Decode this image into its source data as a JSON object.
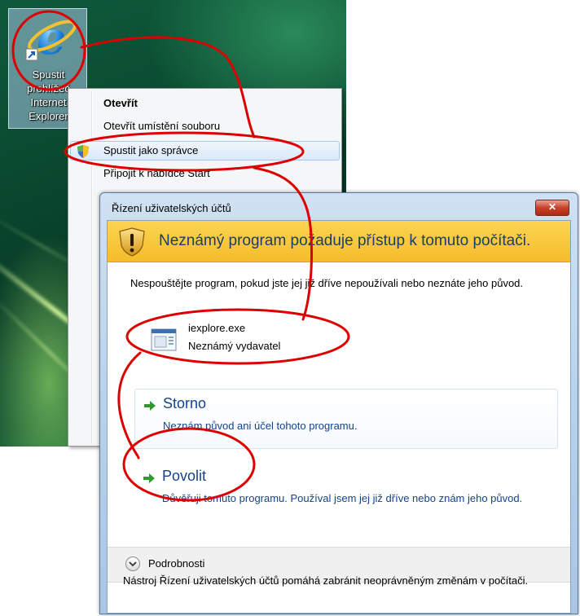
{
  "desktop": {
    "shortcut": {
      "label_lines": [
        "Spustit",
        "prohlížeč",
        "Internet",
        "Explorer"
      ]
    }
  },
  "context_menu": {
    "items": [
      {
        "label": "Otevřít",
        "bold": true
      },
      {
        "label": "Otevřít umístění souboru"
      },
      {
        "label": "Spustit jako správce",
        "highlighted": true,
        "icon": "uac-shield-icon"
      },
      {
        "label": "Připojit k nabídce Start"
      }
    ]
  },
  "uac_dialog": {
    "title": "Řízení uživatelských účtů",
    "close_label": "✕",
    "banner_text": "Neznámý program požaduje přístup k tomuto počítači.",
    "warning_text": "Nespouštějte program, pokud jste jej již dříve nepoužívali nebo neznáte jeho původ.",
    "program": {
      "name": "iexplore.exe",
      "publisher": "Neznámý vydavatel"
    },
    "cancel_option": {
      "title": "Storno",
      "description": "Neznám původ ani účel tohoto programu."
    },
    "allow_option": {
      "title": "Povolit",
      "description": "Důvěřuji tomuto programu. Používal jsem jej již dříve nebo znám jeho původ."
    },
    "details_label": "Podrobnosti",
    "footer_text": "Nástroj Řízení uživatelských účtů pomáhá zabránit neoprávněným změnám v počítači."
  },
  "colors": {
    "annotation": "#dd0000",
    "banner": "#f4bd2a",
    "link_text": "#15428b"
  }
}
